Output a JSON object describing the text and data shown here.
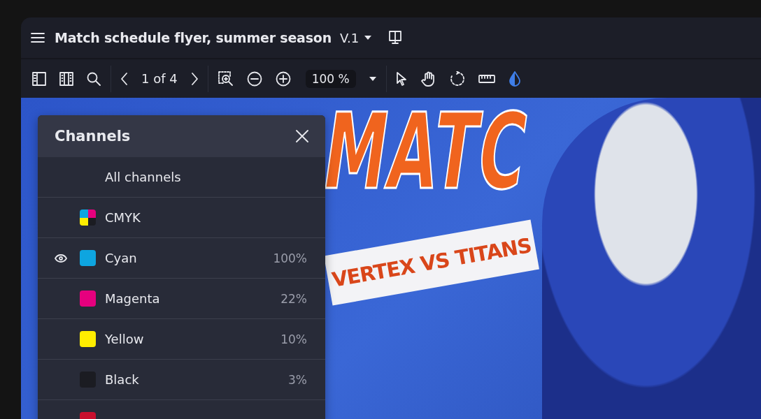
{
  "window": {
    "title": "Match schedule flyer, summer season",
    "version": "V.1"
  },
  "toolbar": {
    "page_indicator": "1 of 4",
    "zoom": "100 %",
    "tools": [
      {
        "kind": "pointer",
        "selected": false
      },
      {
        "kind": "hand",
        "selected": false
      },
      {
        "kind": "rotate",
        "selected": false
      },
      {
        "kind": "ruler",
        "selected": false
      },
      {
        "kind": "color",
        "selected": true
      }
    ]
  },
  "document": {
    "headline": "MATC",
    "banner": "VERTEX VS TITANS"
  },
  "channels_panel": {
    "title": "Channels",
    "items": [
      {
        "name": "All channels",
        "kind": "all",
        "visible": false
      },
      {
        "name": "CMYK",
        "kind": "composite",
        "visible": false
      },
      {
        "name": "Cyan",
        "kind": "ink",
        "color": "#0ea5e0",
        "value": "100%",
        "visible": true
      },
      {
        "name": "Magenta",
        "kind": "ink",
        "color": "#e6007e",
        "value": "22%",
        "visible": false
      },
      {
        "name": "Yellow",
        "kind": "ink",
        "color": "#ffed00",
        "value": "10%",
        "visible": false
      },
      {
        "name": "Black",
        "kind": "ink",
        "color": "#1b1c22",
        "value": "3%",
        "visible": false
      },
      {
        "kind": "ink",
        "color": "#c8102e",
        "visible": false
      }
    ]
  }
}
